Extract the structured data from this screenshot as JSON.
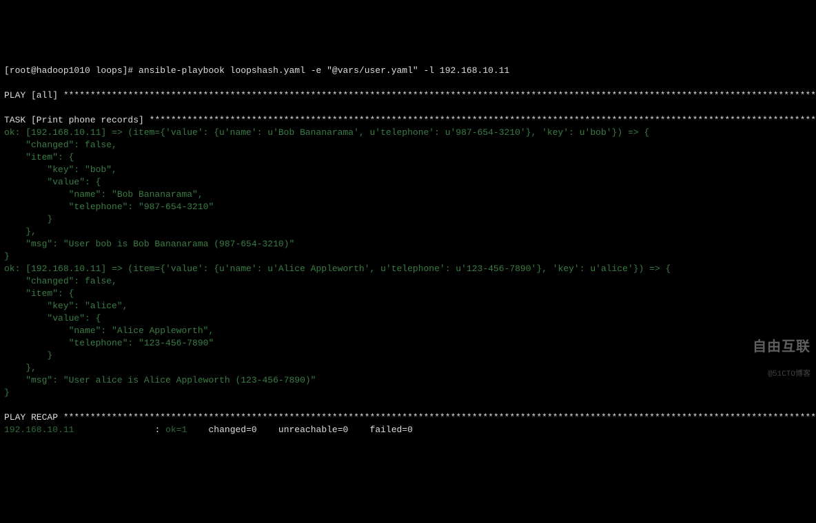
{
  "prompt": {
    "prefix": "[root@hadoop1010 loops]# ",
    "command": "ansible-playbook loopshash.yaml -e \"@vars/user.yaml\" -l 192.168.10.11"
  },
  "play_header": {
    "label": "PLAY [all] ",
    "stars": "**********************************************************************************************************************************************"
  },
  "task_header": {
    "label": "TASK [Print phone records] ",
    "stars": "******************************************************************************************************************************"
  },
  "result1": {
    "prefix": "ok: [192.168.10.11] => (item={'value': {u'name': u'Bob Bananarama', u'telephone': u'987-654-3210'}, 'key': u'bob'}) => {",
    "changed_line": "    \"changed\": false,",
    "item_open": "    \"item\": {",
    "key_line": "        \"key\": \"bob\",",
    "value_open": "        \"value\": {",
    "name_line": "            \"name\": \"Bob Bananarama\",",
    "tel_line": "            \"telephone\": \"987-654-3210\"",
    "value_close": "        }",
    "item_close": "    },",
    "msg_line": "    \"msg\": \"User bob is Bob Bananarama (987-654-3210)\"",
    "close": "}"
  },
  "result2": {
    "prefix": "ok: [192.168.10.11] => (item={'value': {u'name': u'Alice Appleworth', u'telephone': u'123-456-7890'}, 'key': u'alice'}) => {",
    "changed_line": "    \"changed\": false,",
    "item_open": "    \"item\": {",
    "key_line": "        \"key\": \"alice\",",
    "value_open": "        \"value\": {",
    "name_line": "            \"name\": \"Alice Appleworth\",",
    "tel_line": "            \"telephone\": \"123-456-7890\"",
    "value_close": "        }",
    "item_close": "    },",
    "msg_line": "    \"msg\": \"User alice is Alice Appleworth (123-456-7890)\"",
    "close": "}"
  },
  "recap_header": {
    "label": "PLAY RECAP ",
    "stars": "**********************************************************************************************************************************************"
  },
  "recap_line": {
    "host": "192.168.10.11",
    "pad": "               ",
    "ok_prefix": ": ",
    "ok": "ok=1",
    "changed": "    changed=0",
    "unreachable": "    unreachable=0",
    "failed": "    failed=0"
  },
  "watermark": {
    "main": "自由互联",
    "sub": "@51CTO博客"
  }
}
